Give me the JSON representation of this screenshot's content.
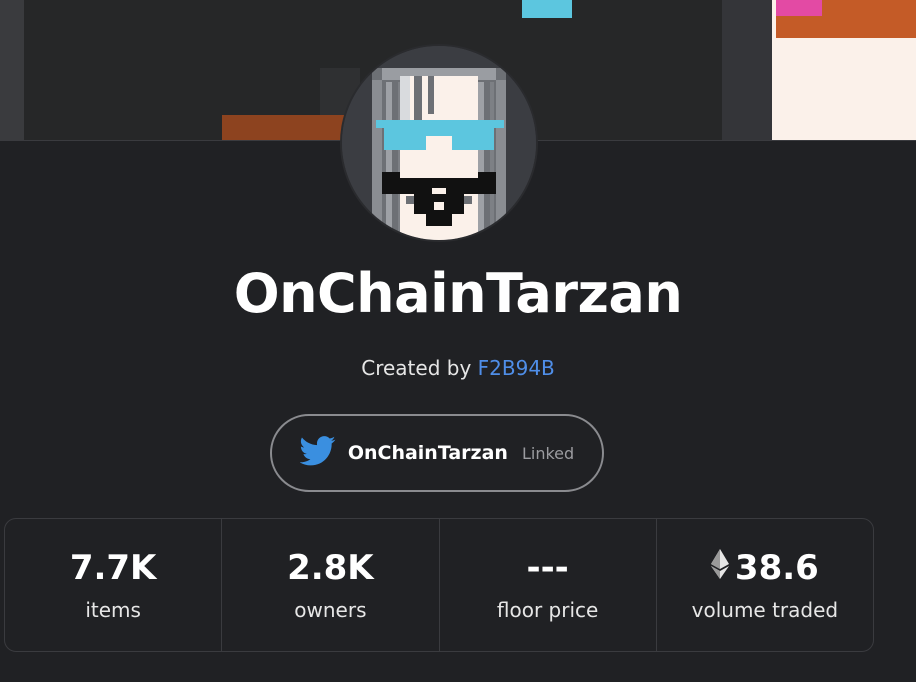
{
  "collection": {
    "title": "OnChainTarzan",
    "created_by_label": "Created by",
    "creator": "F2B94B"
  },
  "social": {
    "icon": "twitter-icon",
    "handle": "OnChainTarzan",
    "status": "Linked"
  },
  "stats": [
    {
      "value": "7.7K",
      "label": "items"
    },
    {
      "value": "2.8K",
      "label": "owners"
    },
    {
      "value": "---",
      "label": "floor price"
    },
    {
      "value": "38.6",
      "label": "volume traded",
      "icon": "ethereum-icon"
    }
  ],
  "colors": {
    "background": "#202124",
    "link": "#4f8ee8",
    "twitter": "#1d9bf0"
  }
}
